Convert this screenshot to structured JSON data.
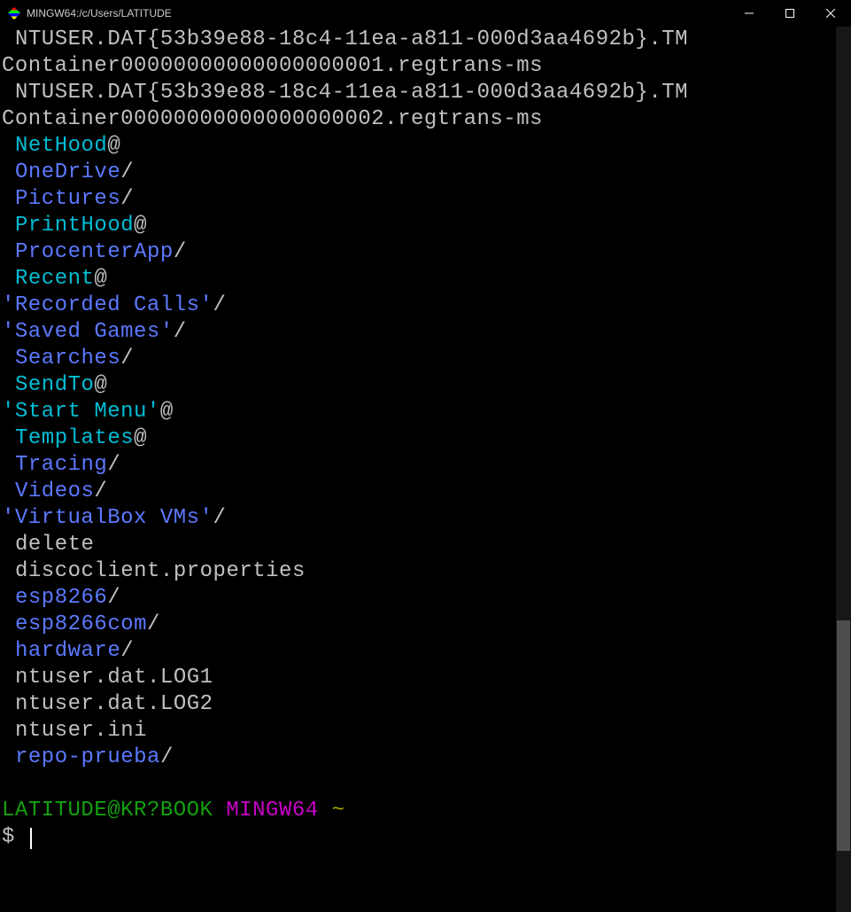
{
  "window": {
    "title": "MINGW64:/c/Users/LATITUDE"
  },
  "lines": [
    {
      "indent": true,
      "segments": [
        {
          "text": "NTUSER.DAT{53b39e88-18c4-11ea-a811-000d3aa4692b}.TM",
          "color": "c-white"
        }
      ]
    },
    {
      "indent": false,
      "segments": [
        {
          "text": "Container00000000000000000001.regtrans-ms",
          "color": "c-white"
        }
      ]
    },
    {
      "indent": true,
      "segments": [
        {
          "text": "NTUSER.DAT{53b39e88-18c4-11ea-a811-000d3aa4692b}.TM",
          "color": "c-white"
        }
      ]
    },
    {
      "indent": false,
      "segments": [
        {
          "text": "Container00000000000000000002.regtrans-ms",
          "color": "c-white"
        }
      ]
    },
    {
      "indent": true,
      "segments": [
        {
          "text": "NetHood",
          "color": "c-cyan"
        },
        {
          "text": "@",
          "color": "c-white"
        }
      ]
    },
    {
      "indent": true,
      "segments": [
        {
          "text": "OneDrive",
          "color": "c-blue"
        },
        {
          "text": "/",
          "color": "c-white"
        }
      ]
    },
    {
      "indent": true,
      "segments": [
        {
          "text": "Pictures",
          "color": "c-blue"
        },
        {
          "text": "/",
          "color": "c-white"
        }
      ]
    },
    {
      "indent": true,
      "segments": [
        {
          "text": "PrintHood",
          "color": "c-cyan"
        },
        {
          "text": "@",
          "color": "c-white"
        }
      ]
    },
    {
      "indent": true,
      "segments": [
        {
          "text": "ProcenterApp",
          "color": "c-blue"
        },
        {
          "text": "/",
          "color": "c-white"
        }
      ]
    },
    {
      "indent": true,
      "segments": [
        {
          "text": "Recent",
          "color": "c-cyan"
        },
        {
          "text": "@",
          "color": "c-white"
        }
      ]
    },
    {
      "indent": false,
      "segments": [
        {
          "text": "'Recorded Calls'",
          "color": "c-blue"
        },
        {
          "text": "/",
          "color": "c-white"
        }
      ]
    },
    {
      "indent": false,
      "segments": [
        {
          "text": "'Saved Games'",
          "color": "c-blue"
        },
        {
          "text": "/",
          "color": "c-white"
        }
      ]
    },
    {
      "indent": true,
      "segments": [
        {
          "text": "Searches",
          "color": "c-blue"
        },
        {
          "text": "/",
          "color": "c-white"
        }
      ]
    },
    {
      "indent": true,
      "segments": [
        {
          "text": "SendTo",
          "color": "c-cyan"
        },
        {
          "text": "@",
          "color": "c-white"
        }
      ]
    },
    {
      "indent": false,
      "segments": [
        {
          "text": "'Start Menu'",
          "color": "c-cyan"
        },
        {
          "text": "@",
          "color": "c-white"
        }
      ]
    },
    {
      "indent": true,
      "segments": [
        {
          "text": "Templates",
          "color": "c-cyan"
        },
        {
          "text": "@",
          "color": "c-white"
        }
      ]
    },
    {
      "indent": true,
      "segments": [
        {
          "text": "Tracing",
          "color": "c-blue"
        },
        {
          "text": "/",
          "color": "c-white"
        }
      ]
    },
    {
      "indent": true,
      "segments": [
        {
          "text": "Videos",
          "color": "c-blue"
        },
        {
          "text": "/",
          "color": "c-white"
        }
      ]
    },
    {
      "indent": false,
      "segments": [
        {
          "text": "'VirtualBox VMs'",
          "color": "c-blue"
        },
        {
          "text": "/",
          "color": "c-white"
        }
      ]
    },
    {
      "indent": true,
      "segments": [
        {
          "text": "delete",
          "color": "c-white"
        }
      ]
    },
    {
      "indent": true,
      "segments": [
        {
          "text": "discoclient.properties",
          "color": "c-white"
        }
      ]
    },
    {
      "indent": true,
      "segments": [
        {
          "text": "esp8266",
          "color": "c-blue"
        },
        {
          "text": "/",
          "color": "c-white"
        }
      ]
    },
    {
      "indent": true,
      "segments": [
        {
          "text": "esp8266com",
          "color": "c-blue"
        },
        {
          "text": "/",
          "color": "c-white"
        }
      ]
    },
    {
      "indent": true,
      "segments": [
        {
          "text": "hardware",
          "color": "c-blue"
        },
        {
          "text": "/",
          "color": "c-white"
        }
      ]
    },
    {
      "indent": true,
      "segments": [
        {
          "text": "ntuser.dat.LOG1",
          "color": "c-white"
        }
      ]
    },
    {
      "indent": true,
      "segments": [
        {
          "text": "ntuser.dat.LOG2",
          "color": "c-white"
        }
      ]
    },
    {
      "indent": true,
      "segments": [
        {
          "text": "ntuser.ini",
          "color": "c-white"
        }
      ]
    },
    {
      "indent": true,
      "segments": [
        {
          "text": "repo-prueba",
          "color": "c-blue"
        },
        {
          "text": "/",
          "color": "c-white"
        }
      ]
    }
  ],
  "prompt": {
    "user_host": "LATITUDE@KR?BOOK",
    "env": "MINGW64",
    "path": "~",
    "symbol": "$"
  }
}
